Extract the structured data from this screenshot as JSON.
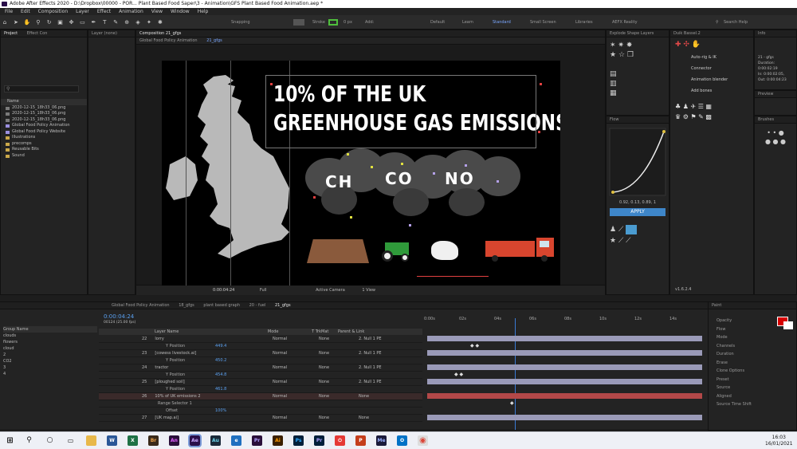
{
  "window": {
    "title": "Adobe After Effects 2020 - D:\\Dropbox\\00000 - POR... Plant Based Food Saper\\3 - Animation\\GFS Plant Based Food Animation.aep *"
  },
  "menu": [
    "File",
    "Edit",
    "Composition",
    "Layer",
    "Effect",
    "Animation",
    "View",
    "Window",
    "Help"
  ],
  "toolbar": {
    "snapping": "Snapping",
    "stroke": "Stroke",
    "px": "0 px",
    "add": "Add:",
    "workspaces": [
      "Default",
      "Learn",
      "Standard",
      "Small Screen",
      "Libraries",
      "AEFX Reality"
    ],
    "search": "Search Help"
  },
  "project": {
    "tabs": [
      "Project",
      "Effect Con"
    ],
    "search_placeholder": "",
    "header": "Name",
    "items": [
      "2020-12-15_18h33_06.png",
      "2020-12-15_18h33_06.png",
      "2020-12-15_18h33_06.png",
      "Global Food Policy Animation",
      "Global Food Policy Website",
      "Illustrations",
      "precomps",
      "Reusable Bits",
      "Sound"
    ]
  },
  "layer_panel": {
    "label": "Layer (none)"
  },
  "composition": {
    "tab": "Composition 21_gfgs",
    "breadcrumb": [
      "Global Food Policy Animation",
      "21_gfgs"
    ],
    "headline_line1": "10% OF THE UK",
    "headline_line2": "GREENHOUSE GAS EMISSIONS",
    "gas_labels": [
      "CH",
      "CO",
      "NO"
    ],
    "timecode": "0:00:04:24",
    "zoom": "Full",
    "camera": "Active Camera",
    "view": "1 View"
  },
  "right_panels": {
    "tabs": [
      "Explode Shape Layers",
      "Duik Bassel.2",
      "Info"
    ],
    "duik_items": [
      "Auto-rig & IK",
      "Connector",
      "Animation blender",
      "Add bones"
    ],
    "flow_tab": "Flow",
    "apply_label": "APPLY",
    "ease_label": "0.92, 0.13, 0.89, 1",
    "preview_tab": "Preview",
    "brushes_tab": "Brushes",
    "info_lines": [
      "21 - gfgs",
      "Duration: 0:00:02:19",
      "In: 0:00:02:05, Out: 0:00:04:23"
    ],
    "version": "v1.6.2.4"
  },
  "paint": {
    "tab": "Paint",
    "labels": [
      "Opacity",
      "Flow",
      "Mode",
      "Channels",
      "Duration",
      "Erase",
      "Clone Options",
      "Preset",
      "Source",
      "Aligned",
      "Source Time Shift"
    ],
    "foreground_color": "#d60000"
  },
  "timeline": {
    "tabs": [
      "Global Food Policy Animation",
      "18_gfgs",
      "plant based graph",
      "20 - fuel",
      "21_gfgs"
    ],
    "timecode": "0:00:04:24",
    "frames": "00124 (25.00 fps)",
    "columns": [
      "Layer Name",
      "Mode",
      "T TrkMat",
      "Parent & Link"
    ],
    "ruler": [
      "0:00s",
      "02s",
      "04s",
      "06s",
      "08s",
      "10s",
      "12s",
      "14s"
    ],
    "layers": [
      {
        "num": "22",
        "name": "lorry",
        "mode": "Normal",
        "trk": "None",
        "parent": "2. Null 1 PE"
      },
      {
        "num": "",
        "name": "Y Position",
        "mode": "",
        "trk": "",
        "parent": "449.4"
      },
      {
        "num": "23",
        "name": "[cowess livestock.ai]",
        "mode": "Normal",
        "trk": "None",
        "parent": "2. Null 1 PE"
      },
      {
        "num": "",
        "name": "Y Position",
        "mode": "",
        "trk": "",
        "parent": "450.2"
      },
      {
        "num": "24",
        "name": "tractor",
        "mode": "Normal",
        "trk": "None",
        "parent": "2. Null 1 PE"
      },
      {
        "num": "",
        "name": "Y Position",
        "mode": "",
        "trk": "",
        "parent": "454.8"
      },
      {
        "num": "25",
        "name": "[ploughed soil]",
        "mode": "Normal",
        "trk": "None",
        "parent": "2. Null 1 PE"
      },
      {
        "num": "",
        "name": "Y Position",
        "mode": "",
        "trk": "",
        "parent": "461.8"
      },
      {
        "num": "26",
        "name": "10% of UK emissions 2",
        "mode": "Normal",
        "trk": "None",
        "parent": "None"
      },
      {
        "num": "",
        "name": "Range Selector 1",
        "mode": "",
        "trk": "",
        "parent": ""
      },
      {
        "num": "",
        "name": "Offset",
        "mode": "",
        "trk": "",
        "parent": "100%"
      },
      {
        "num": "27",
        "name": "[UK map.ai]",
        "mode": "Normal",
        "trk": "None",
        "parent": "None"
      }
    ],
    "groups": [
      "Group Name",
      "clouds",
      "flowers",
      "cloud",
      "2",
      "CO2",
      "3",
      "4"
    ]
  },
  "taskbar": {
    "time": "16:03",
    "date": "16/01/2021",
    "apps": [
      "Windows",
      "Search",
      "Cortana",
      "Task View",
      "Explorer",
      "Word",
      "Excel",
      "Bridge",
      "Animate",
      "After Effects",
      "Audition",
      "Edge",
      "Premiere",
      "Illustrator",
      "Photoshop",
      "Premiere Rush",
      "Acrobat",
      "PowerPoint",
      "Media Encoder",
      "Outlook",
      "Chrome"
    ]
  }
}
